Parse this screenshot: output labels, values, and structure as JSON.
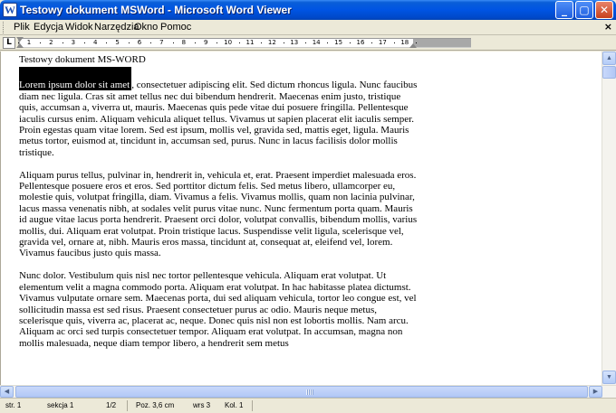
{
  "window": {
    "title": "Testowy dokument MSWord - Microsoft Word Viewer",
    "minimize_icon": "minimize-icon",
    "maximize_icon": "maximize-icon",
    "close_icon": "close-icon"
  },
  "menu": {
    "items": [
      "Plik",
      "Edycja",
      "Widok",
      "Narzędzia",
      "Okno",
      "Pomoc"
    ],
    "close_glyph": "×"
  },
  "ruler": {
    "tab_selector": "L",
    "numbers": [
      "1",
      "2",
      "3",
      "4",
      "5",
      "6",
      "7",
      "8",
      "9",
      "10",
      "11",
      "12",
      "13",
      "14",
      "15",
      "16",
      "17",
      "18"
    ]
  },
  "document": {
    "title": "Testowy dokument MS-WORD",
    "selected_text": "Lorem ipsum dolor sit amet",
    "para1_rest": ", consectetuer adipiscing elit. Sed dictum rhoncus ligula. Nunc faucibus diam nec ligula. Cras sit amet tellus nec dui bibendum hendrerit. Maecenas enim justo, tristique quis, accumsan a, viverra ut, mauris. Maecenas quis pede vitae dui posuere fringilla. Pellentesque iaculis cursus enim. Aliquam vehicula aliquet tellus. Vivamus ut sapien placerat elit iaculis semper. Proin egestas quam vitae lorem. Sed est ipsum, mollis vel, gravida sed, mattis eget, ligula. Mauris metus tortor, euismod at, tincidunt in, accumsan sed, purus. Nunc in lacus facilisis dolor mollis tristique.",
    "para2": "Aliquam purus tellus, pulvinar in, hendrerit in, vehicula et, erat. Praesent imperdiet malesuada eros. Pellentesque posuere eros et eros. Sed porttitor dictum felis. Sed metus libero, ullamcorper eu, molestie quis, volutpat fringilla, diam. Vivamus a felis. Vivamus mollis, quam non lacinia pulvinar, lacus massa venenatis nibh, at sodales velit purus vitae nunc. Nunc fermentum porta quam. Mauris id augue vitae lacus porta hendrerit. Praesent orci dolor, volutpat convallis, bibendum mollis, varius mollis, dui. Aliquam erat volutpat. Proin tristique lacus. Suspendisse velit ligula, scelerisque vel, gravida vel, ornare at, nibh. Mauris eros massa, tincidunt at, consequat at, eleifend vel, lorem. Vivamus faucibus justo quis massa.",
    "para3": "Nunc dolor. Vestibulum quis nisl nec tortor pellentesque vehicula. Aliquam erat volutpat. Ut elementum velit a magna commodo porta. Aliquam erat volutpat. In hac habitasse platea dictumst. Vivamus vulputate ornare sem. Maecenas porta, dui sed aliquam vehicula, tortor leo congue est, vel sollicitudin massa est sed risus. Praesent consectetuer purus ac odio. Mauris neque metus, scelerisque quis, viverra ac, placerat ac, neque. Donec quis nisl non est lobortis mollis. Nam arcu. Aliquam ac orci sed turpis consectetuer tempor. Aliquam erat volutpat. In accumsan, magna non mollis malesuada, neque diam tempor libero, a hendrerit sem metus"
  },
  "scrollbar": {
    "up_arrow": "▲",
    "down_arrow": "▼",
    "left_arrow": "◀",
    "right_arrow": "▶"
  },
  "status": {
    "page": "str.  1",
    "section": "sekcja  1",
    "pages": "1/2",
    "position": "Poz.  3,6 cm",
    "line": "wrs  3",
    "column": "Kol.  1"
  }
}
